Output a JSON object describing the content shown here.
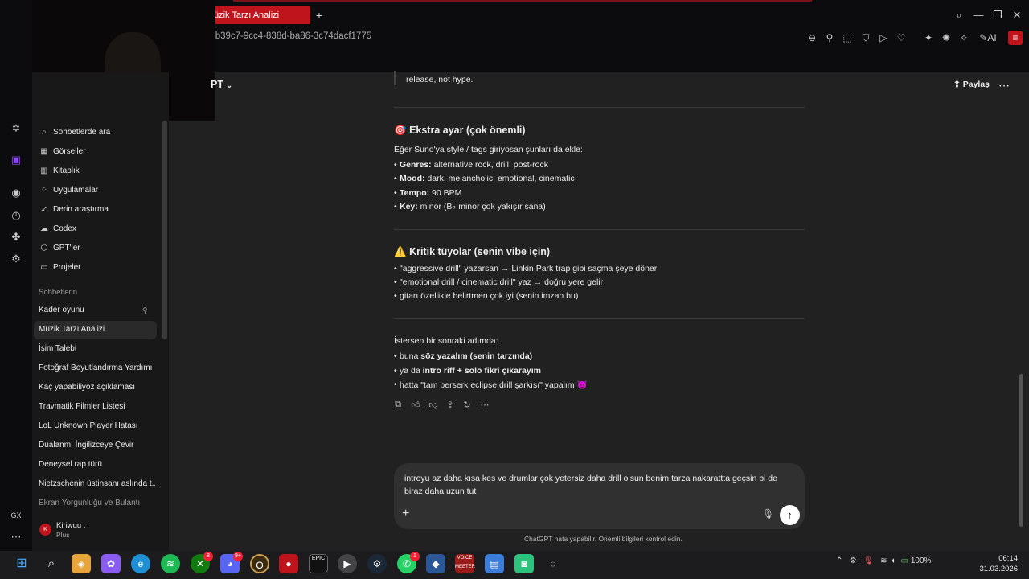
{
  "browser": {
    "tab_title": "üzik Tarzı Analizi",
    "url": "cb39c7-9cc4-838d-ba86-3c74dacf1775",
    "toolbar_ai_label": "AI"
  },
  "header": {
    "model_label": "PT",
    "share_label": "Paylaş"
  },
  "sidebar": {
    "nav": [
      {
        "label": "Sohbetlerde ara",
        "icon": "search-icon"
      },
      {
        "label": "Görseller",
        "icon": "image-icon"
      },
      {
        "label": "Kitaplık",
        "icon": "library-icon"
      },
      {
        "label": "Uygulamalar",
        "icon": "apps-icon"
      },
      {
        "label": "Derin araştırma",
        "icon": "telescope-icon"
      },
      {
        "label": "Codex",
        "icon": "codex-icon"
      },
      {
        "label": "GPT'ler",
        "icon": "gpts-icon"
      },
      {
        "label": "Projeler",
        "icon": "folder-icon"
      }
    ],
    "section_title": "Sohbetlerin",
    "chats": [
      "Kader oyunu",
      "Müzik Tarzı Analizi",
      "İsim Talebi",
      "Fotoğraf Boyutlandırma Yardımı",
      "Kaç yapabiliyoz açıklaması",
      "Travmatik Filmler Listesi",
      "LoL Unknown Player Hatası",
      "Dualanmı İngilizceye Çevir",
      "Deneysel rap türü",
      "Nietzschenin üstinsanı aslında t...",
      "Ekran Yorgunluğu ve Bulantı"
    ],
    "user": {
      "initial": "K",
      "name": "Kiriwuu .",
      "plan": "Plus"
    }
  },
  "message": {
    "quote_tail": "release, not hype.",
    "section1": {
      "emoji": "🎯",
      "title": "Ekstra ayar (çok önemli)",
      "intro": "Eğer Suno'ya style / tags giriyosan şunları da ekle:",
      "items": [
        {
          "key": "Genres:",
          "value": " alternative rock, drill, post-rock"
        },
        {
          "key": "Mood:",
          "value": " dark, melancholic, emotional, cinematic"
        },
        {
          "key": "Tempo:",
          "value": " 90 BPM"
        },
        {
          "key": "Key:",
          "value": " minor (B♭ minor çok yakışır sana)"
        }
      ]
    },
    "section2": {
      "emoji": "⚠️",
      "title": "Kritik tüyolar (senin vibe için)",
      "items": [
        "\"aggressive drill\" yazarsan → Linkin Park trap gibi saçma şeye döner",
        "\"emotional drill / cinematic drill\" yaz → doğru yere gelir",
        "gitarı özellikle belirtmen çok iyi (senin imzan bu)"
      ]
    },
    "section3": {
      "intro": "İstersen bir sonraki adımda:",
      "items": [
        {
          "pre": "buna ",
          "bold": "söz yazalım (senin tarzında)",
          "post": ""
        },
        {
          "pre": "ya da ",
          "bold": "intro riff + solo fikri çıkarayım",
          "post": ""
        },
        {
          "pre": "hatta \"tam berserk eclipse drill şarkısı\" yapalım ",
          "bold": "",
          "post": "😈"
        }
      ]
    }
  },
  "composer": {
    "text": "introyu az daha kısa kes ve drumlar çok yetersiz daha drill olsun benim tarza nakarattta geçsin bi de biraz daha uzun tut",
    "disclaimer": "ChatGPT hata yapabilir. Önemli bilgileri kontrol edin."
  },
  "taskbar": {
    "badges": {
      "xbox": "8",
      "discord": "9+",
      "whatsapp": "1"
    },
    "voicemeeter_label": "VOICE MEETER",
    "battery": "100%",
    "time": "06:14",
    "date": "31.03.2026"
  },
  "colors": {
    "accent_red": "#c0141c",
    "bg_main": "#212121",
    "bg_sidebar": "#181818"
  }
}
